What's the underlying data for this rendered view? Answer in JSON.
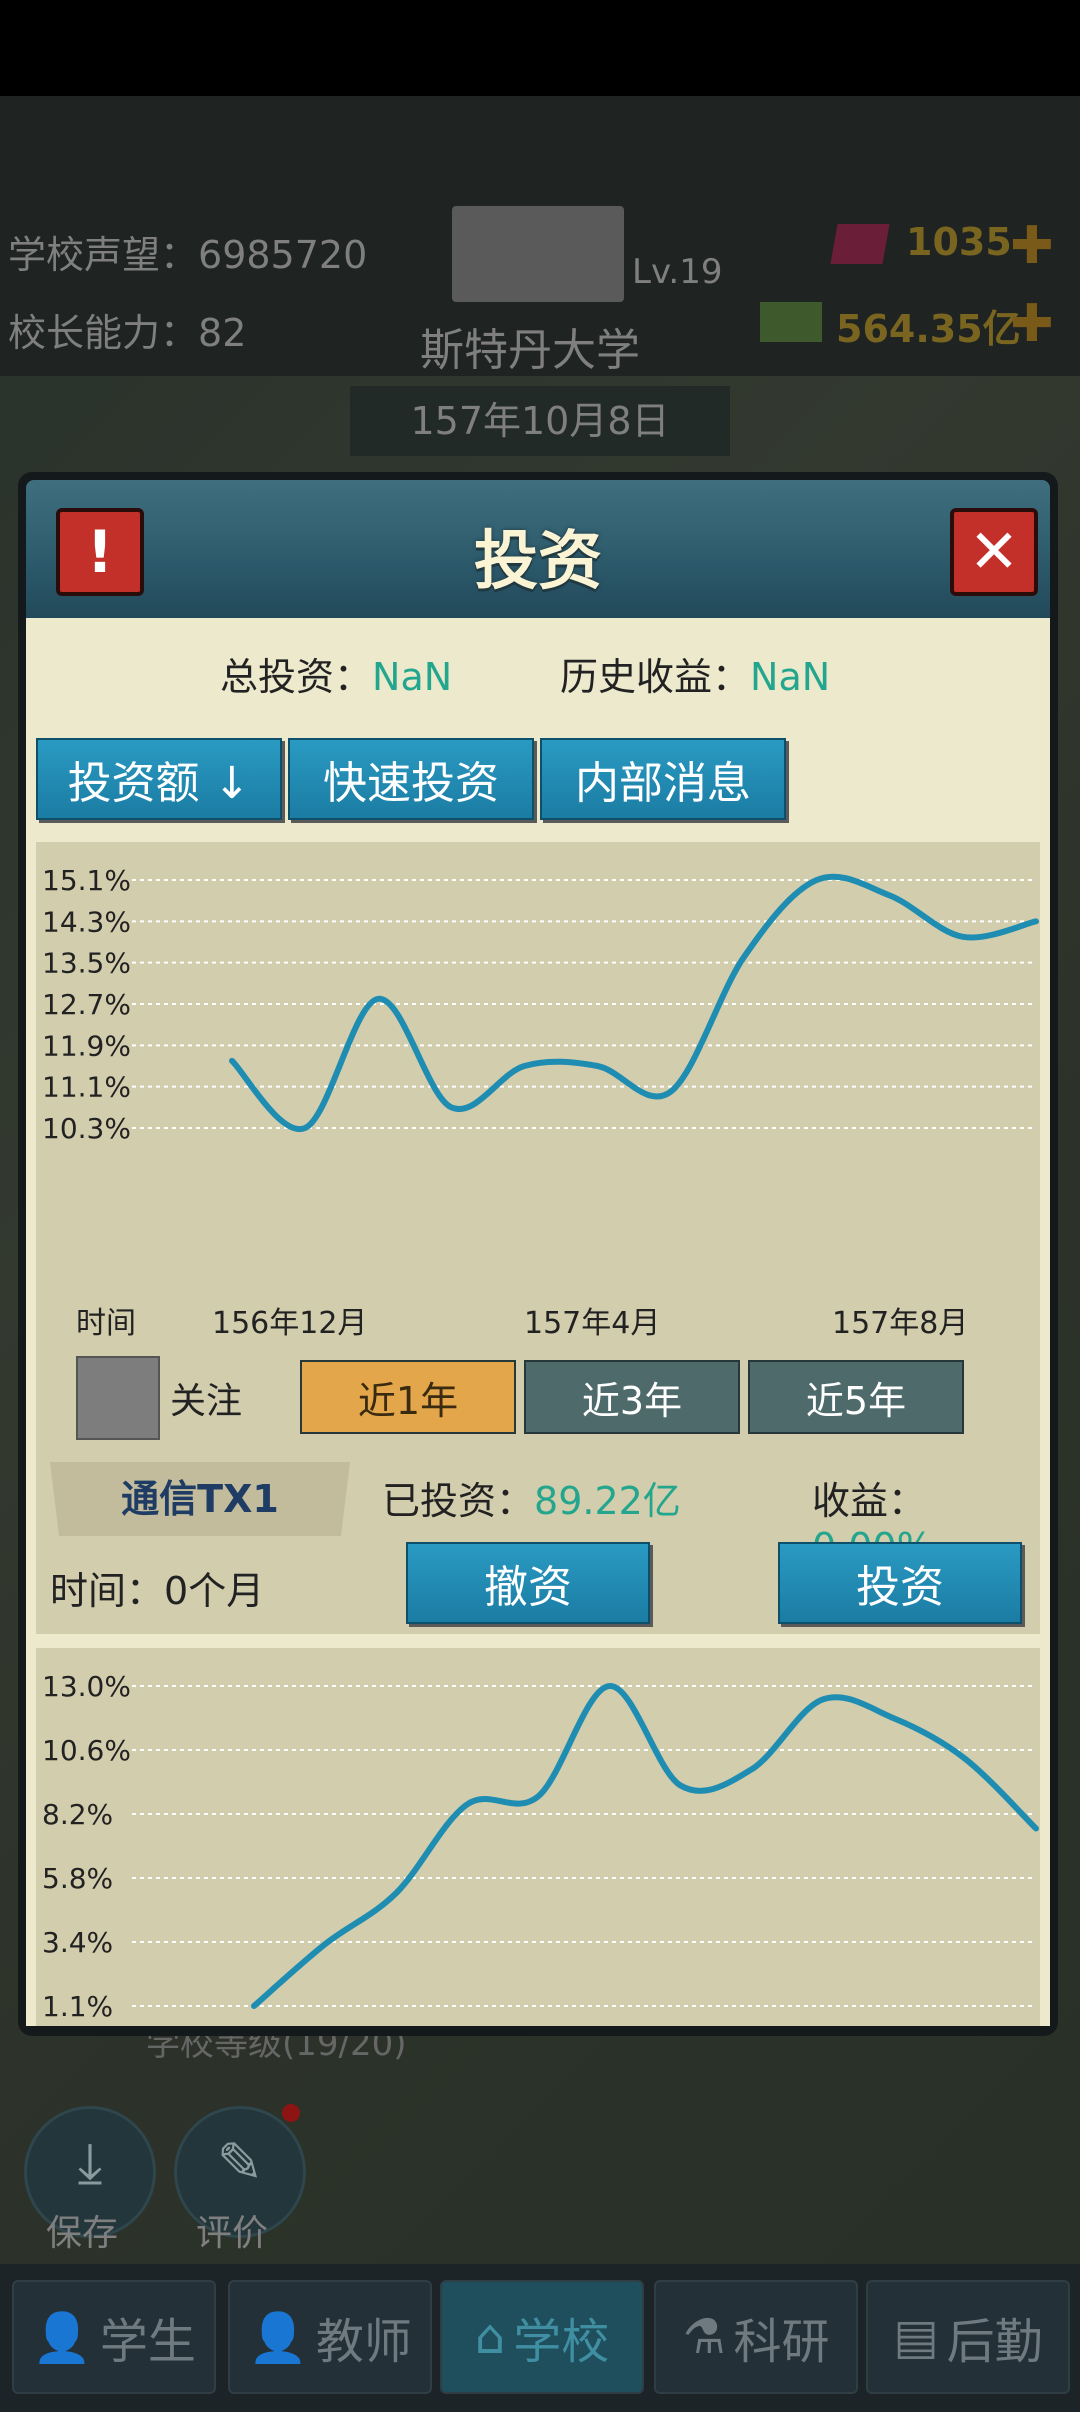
{
  "scene": {
    "reputation_label": "学校声望：",
    "reputation_value": "6985720",
    "ability_label": "校长能力：",
    "ability_value": "82",
    "school_name": "斯特丹大学",
    "school_level": "Lv.19",
    "gems": "1035",
    "money": "564.35亿",
    "date": "157年10月8日",
    "school_grade": "学校等级(19/20)",
    "save_label": "保存",
    "review_label": "评价",
    "tabs": [
      {
        "label": "学生"
      },
      {
        "label": "教师"
      },
      {
        "label": "学校"
      },
      {
        "label": "科研"
      },
      {
        "label": "后勤"
      }
    ]
  },
  "dialog": {
    "title": "投资",
    "total_label": "总投资：",
    "total_value": "NaN",
    "history_label": "历史收益：",
    "history_value": "NaN",
    "buttons": {
      "sort": "投资额 ↓",
      "quick": "快速投资",
      "insider": "内部消息"
    },
    "stock": {
      "time_axis_label": "时间",
      "follow_label": "关注",
      "ranges": [
        "近1年",
        "近3年",
        "近5年"
      ],
      "selected_range": "近1年",
      "name": "通信TX1",
      "invested_label": "已投资：",
      "invested_value": "89.22亿",
      "profit_label": "收益：",
      "profit_value": "0.00%",
      "time_label": "时间：",
      "time_value": "0个月",
      "divest_button": "撤资",
      "invest_button": "投资"
    }
  },
  "colors": {
    "line": "#1f8db2",
    "value_green": "#23a68d",
    "selected_range": "#e3a64a"
  },
  "chart_data": [
    {
      "type": "line",
      "title": "",
      "yticks": [
        "15.1%",
        "14.3%",
        "13.5%",
        "12.7%",
        "11.9%",
        "11.1%",
        "10.3%"
      ],
      "ylim": [
        10.3,
        15.1
      ],
      "xticks": [
        "156年12月",
        "157年4月",
        "157年8月"
      ],
      "series": [
        {
          "values": [
            11.6,
            10.3,
            12.8,
            10.7,
            11.5,
            11.5,
            11.0,
            13.6,
            15.1,
            14.8,
            14.0,
            14.3
          ]
        }
      ],
      "grid": true
    },
    {
      "type": "line",
      "title": "",
      "yticks": [
        "13.0%",
        "10.6%",
        "8.2%",
        "5.8%",
        "3.4%",
        "1.1%"
      ],
      "ylim": [
        1.1,
        13.0
      ],
      "series": [
        {
          "values": [
            1.1,
            3.4,
            5.3,
            8.6,
            8.9,
            13.0,
            9.3,
            9.9,
            12.5,
            11.8,
            10.3,
            7.7
          ]
        }
      ],
      "grid": true
    }
  ]
}
